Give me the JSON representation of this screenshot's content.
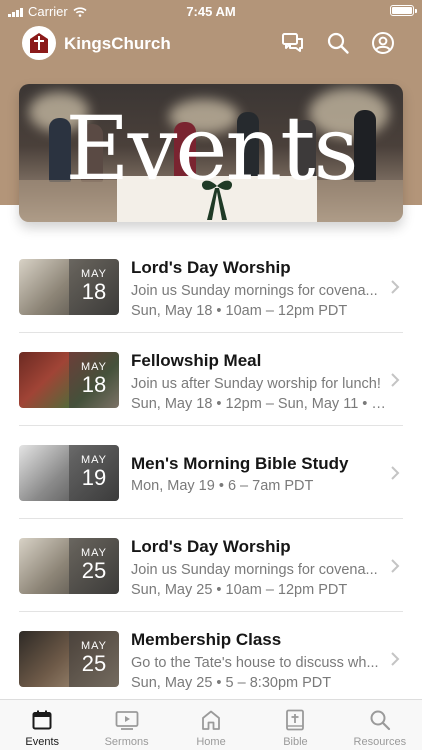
{
  "status": {
    "carrier": "Carrier",
    "time": "7:45 AM"
  },
  "header": {
    "title": "KingsChurch",
    "icons": [
      "chat-icon",
      "search-icon",
      "profile-icon"
    ]
  },
  "banner": {
    "title": "Events"
  },
  "events": [
    {
      "month": "MAY",
      "day": "18",
      "title": "Lord's Day Worship",
      "description": "Join us Sunday mornings for covena...",
      "when": "Sun, May 18 • 10am – 12pm PDT"
    },
    {
      "month": "MAY",
      "day": "18",
      "title": "Fellowship Meal",
      "description": "Join us after Sunday worship for lunch!",
      "when": "Sun, May 18 • 12pm – Sun, May 11 • 1..."
    },
    {
      "month": "MAY",
      "day": "19",
      "title": "Men's Morning Bible Study",
      "description": "",
      "when": "Mon, May 19 • 6 – 7am PDT"
    },
    {
      "month": "MAY",
      "day": "25",
      "title": "Lord's Day Worship",
      "description": "Join us Sunday mornings for covena...",
      "when": "Sun, May 25 • 10am – 12pm PDT"
    },
    {
      "month": "MAY",
      "day": "25",
      "title": "Membership Class",
      "description": "Go to the Tate's house to discuss wh...",
      "when": "Sun, May 25 • 5 – 8:30pm PDT"
    }
  ],
  "tabs": [
    {
      "label": "Events",
      "icon": "calendar-icon",
      "active": true
    },
    {
      "label": "Sermons",
      "icon": "video-icon",
      "active": false
    },
    {
      "label": "Home",
      "icon": "home-icon",
      "active": false
    },
    {
      "label": "Bible",
      "icon": "bible-icon",
      "active": false
    },
    {
      "label": "Resources",
      "icon": "search-icon",
      "active": false
    }
  ],
  "colors": {
    "hero": "#b39579",
    "accent": "#8b1a1a",
    "tab_active": "#1a1a1a",
    "tab_inactive": "#9a9a9a"
  }
}
